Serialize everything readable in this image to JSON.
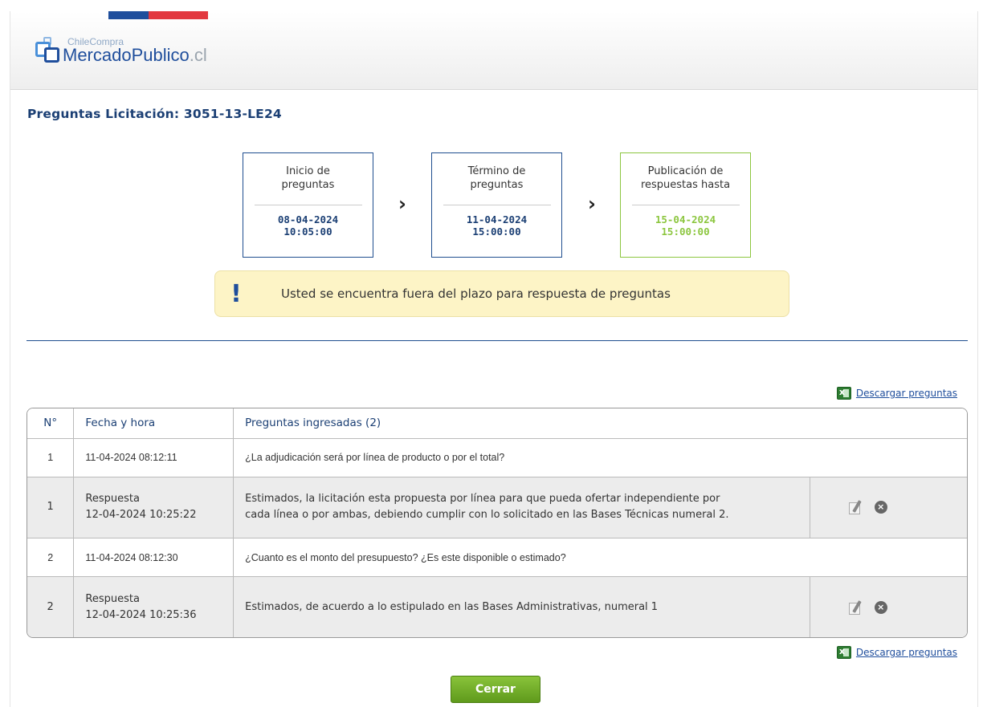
{
  "brand": {
    "sub": "ChileCompra",
    "main": "MercadoPublico",
    "suffix": ".cl"
  },
  "page_title": "Preguntas Licitación: 3051-13-LE24",
  "timeline": [
    {
      "label_line1": "Inicio de",
      "label_line2": "preguntas",
      "date": "08-04-2024",
      "time": "10:05:00"
    },
    {
      "label_line1": "Término de",
      "label_line2": "preguntas",
      "date": "11-04-2024",
      "time": "15:00:00"
    },
    {
      "label_line1": "Publicación de",
      "label_line2": "respuestas hasta",
      "date": "15-04-2024",
      "time": "15:00:00"
    }
  ],
  "alert": {
    "mark": "!",
    "message": "Usted se encuentra fuera del plazo para respuesta de preguntas"
  },
  "download_label": "Descargar preguntas",
  "table": {
    "headers": [
      "N°",
      "Fecha y hora",
      "Preguntas ingresadas (2)"
    ],
    "rows": [
      {
        "n": "1",
        "fecha": "11-04-2024 08:12:11",
        "texto": "¿La adjudicación será por línea de producto o por el total?"
      },
      {
        "n": "1",
        "tipo": "Respuesta",
        "fecha": "12-04-2024 10:25:22",
        "texto_l1": "Estimados, la licitación esta propuesta por línea para que pueda ofertar independiente por",
        "texto_l2": "cada línea o por ambas, debiendo cumplir con lo solicitado en las Bases Técnicas numeral 2."
      },
      {
        "n": "2",
        "fecha": "11-04-2024 08:12:30",
        "texto": "¿Cuanto es el monto del presupuesto? ¿Es este disponible o estimado?"
      },
      {
        "n": "2",
        "tipo": "Respuesta",
        "fecha": "12-04-2024 10:25:36",
        "texto": "Estimados, de acuerdo a lo estipulado en las Bases Administrativas, numeral 1"
      }
    ]
  },
  "close_button": "Cerrar",
  "icons": [
    "excel-icon",
    "edit-icon",
    "delete-icon",
    "chevron-right-icon",
    "exclamation-icon"
  ],
  "colors": {
    "primary_blue": "#1b3f74",
    "accent_green": "#8cc63f",
    "alert_bg": "#fdf4c6",
    "answer_row_bg": "#ececec"
  }
}
